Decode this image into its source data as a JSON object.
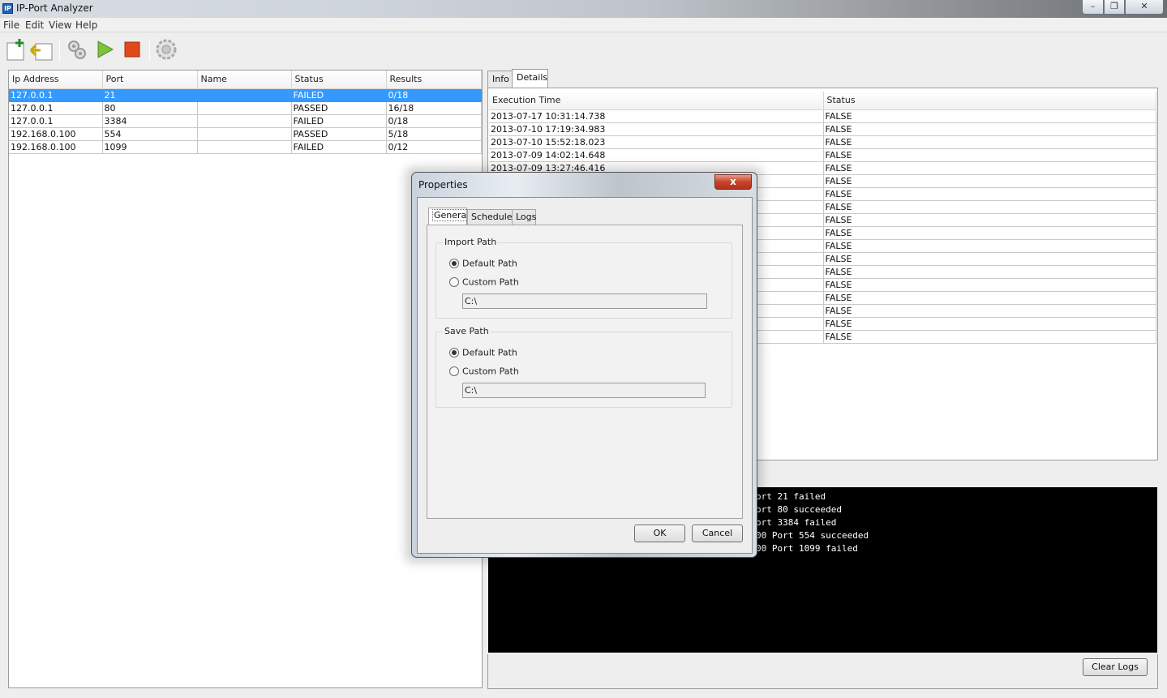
{
  "window": {
    "title": "IP-Port Analyzer",
    "icon_text": "IP"
  },
  "menu": [
    "File",
    "Edit",
    "View",
    "Help"
  ],
  "toolbar": {
    "icons": [
      "new-icon",
      "import-icon",
      "settings-gears-icon",
      "play-icon",
      "stop-icon",
      "gear-icon"
    ]
  },
  "left_table": {
    "columns": [
      "Ip Address",
      "Port",
      "Name",
      "Status",
      "Results"
    ],
    "rows": [
      {
        "ip": "127.0.0.1",
        "port": "21",
        "name": "",
        "status": "FAILED",
        "results": "0/18",
        "selected": true
      },
      {
        "ip": "127.0.0.1",
        "port": "80",
        "name": "",
        "status": "PASSED",
        "results": "16/18"
      },
      {
        "ip": "127.0.0.1",
        "port": "3384",
        "name": "",
        "status": "FAILED",
        "results": "0/18"
      },
      {
        "ip": "192.168.0.100",
        "port": "554",
        "name": "",
        "status": "PASSED",
        "results": "5/18"
      },
      {
        "ip": "192.168.0.100",
        "port": "1099",
        "name": "",
        "status": "FAILED",
        "results": "0/12"
      }
    ]
  },
  "right_tabs": [
    "Info",
    "Details"
  ],
  "details_table": {
    "columns": [
      "Execution Time",
      "Status"
    ],
    "rows": [
      {
        "time": "2013-07-17 10:31:14.738",
        "status": "FALSE"
      },
      {
        "time": "2013-07-10 17:19:34.983",
        "status": "FALSE"
      },
      {
        "time": "2013-07-10 15:52:18.023",
        "status": "FALSE"
      },
      {
        "time": "2013-07-09 14:02:14.648",
        "status": "FALSE"
      },
      {
        "time": "2013-07-09 13:27:46.416",
        "status": "FALSE"
      },
      {
        "time": "",
        "status": "FALSE"
      },
      {
        "time": "",
        "status": "FALSE"
      },
      {
        "time": "",
        "status": "FALSE"
      },
      {
        "time": "",
        "status": "FALSE"
      },
      {
        "time": "",
        "status": "FALSE"
      },
      {
        "time": "",
        "status": "FALSE"
      },
      {
        "time": "",
        "status": "FALSE"
      },
      {
        "time": "",
        "status": "FALSE"
      },
      {
        "time": "",
        "status": "FALSE"
      },
      {
        "time": "",
        "status": "FALSE"
      },
      {
        "time": "",
        "status": "FALSE"
      },
      {
        "time": "",
        "status": "FALSE"
      },
      {
        "time": "",
        "status": "FALSE"
      }
    ]
  },
  "console": {
    "lines": [
      "ort 21 failed",
      "ort 80 succeeded",
      "ort 3384 failed",
      "00 Port 554 succeeded",
      "00 Port 1099 failed"
    ]
  },
  "clear_logs_label": "Clear Logs",
  "dialog": {
    "title": "Properties",
    "close_glyph": "x",
    "tabs": [
      "General",
      "Schedule",
      "Logs"
    ],
    "import_group": {
      "title": "Import Path",
      "default_label": "Default Path",
      "custom_label": "Custom Path",
      "path_value": "C:\\",
      "selected": "default"
    },
    "save_group": {
      "title": "Save Path",
      "default_label": "Default Path",
      "custom_label": "Custom Path",
      "path_value": "C:\\",
      "selected": "default"
    },
    "ok_label": "OK",
    "cancel_label": "Cancel"
  },
  "colors": {
    "selection": "#3399ff",
    "console_bg": "#000000",
    "close_red": "#c7422b"
  }
}
